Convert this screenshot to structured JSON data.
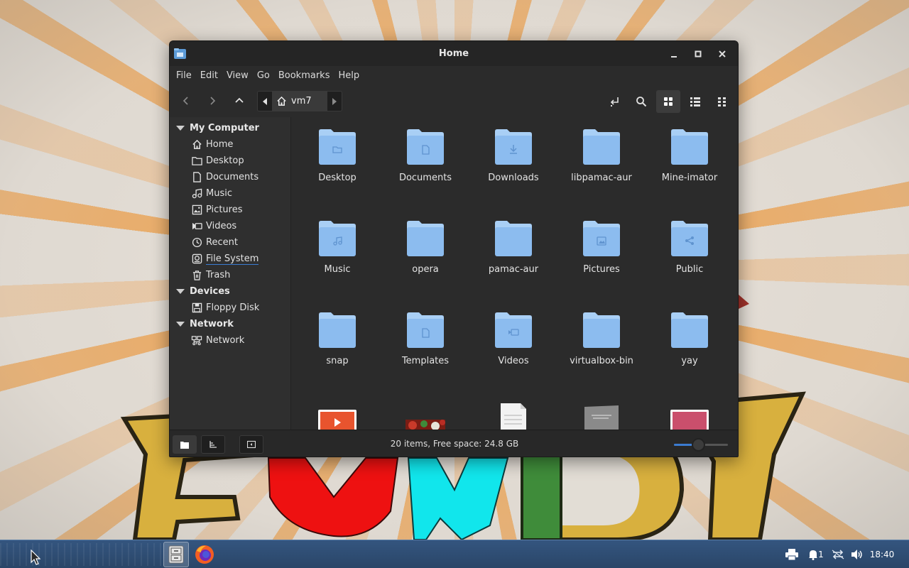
{
  "window": {
    "title": "Home",
    "controls": {
      "minimize": "minimize-icon",
      "maximize": "maximize-icon",
      "close": "close-icon"
    }
  },
  "menubar": [
    "File",
    "Edit",
    "View",
    "Go",
    "Bookmarks",
    "Help"
  ],
  "location": {
    "current": "vm7"
  },
  "sidebar": {
    "sections": [
      {
        "label": "My Computer",
        "items": [
          {
            "label": "Home",
            "icon": "home-icon"
          },
          {
            "label": "Desktop",
            "icon": "folder-icon"
          },
          {
            "label": "Documents",
            "icon": "document-icon"
          },
          {
            "label": "Music",
            "icon": "music-icon"
          },
          {
            "label": "Pictures",
            "icon": "image-icon"
          },
          {
            "label": "Videos",
            "icon": "video-icon"
          },
          {
            "label": "Recent",
            "icon": "clock-icon"
          },
          {
            "label": "File System",
            "icon": "drive-icon"
          },
          {
            "label": "Trash",
            "icon": "trash-icon"
          }
        ]
      },
      {
        "label": "Devices",
        "items": [
          {
            "label": "Floppy Disk",
            "icon": "floppy-icon"
          }
        ]
      },
      {
        "label": "Network",
        "items": [
          {
            "label": "Network",
            "icon": "network-icon"
          }
        ]
      }
    ]
  },
  "files": [
    {
      "name": "Desktop",
      "emblem": "folder"
    },
    {
      "name": "Documents",
      "emblem": "document"
    },
    {
      "name": "Downloads",
      "emblem": "download"
    },
    {
      "name": "libpamac-aur",
      "emblem": ""
    },
    {
      "name": "Mine-imator",
      "emblem": ""
    },
    {
      "name": "Music",
      "emblem": "music"
    },
    {
      "name": "opera",
      "emblem": ""
    },
    {
      "name": "pamac-aur",
      "emblem": ""
    },
    {
      "name": "Pictures",
      "emblem": "picture"
    },
    {
      "name": "Public",
      "emblem": "share"
    },
    {
      "name": "snap",
      "emblem": ""
    },
    {
      "name": "Templates",
      "emblem": "document"
    },
    {
      "name": "Videos",
      "emblem": "video"
    },
    {
      "name": "virtualbox-bin",
      "emblem": ""
    },
    {
      "name": "yay",
      "emblem": ""
    }
  ],
  "partial_files": [
    "video-thumbnail",
    "photo-thumbnail",
    "text-file",
    "disk-image",
    "gradient-image"
  ],
  "status": {
    "text": "20 items, Free space: 24.8 GB",
    "zoom_level": 0.45
  },
  "taskbar": {
    "clock": "18:40",
    "notification_count": "1"
  },
  "colors": {
    "folder": "#8cbcef",
    "folder_tab": "#a9cff5",
    "accent": "#3b7bd0",
    "taskbar": "#2f4e75"
  }
}
